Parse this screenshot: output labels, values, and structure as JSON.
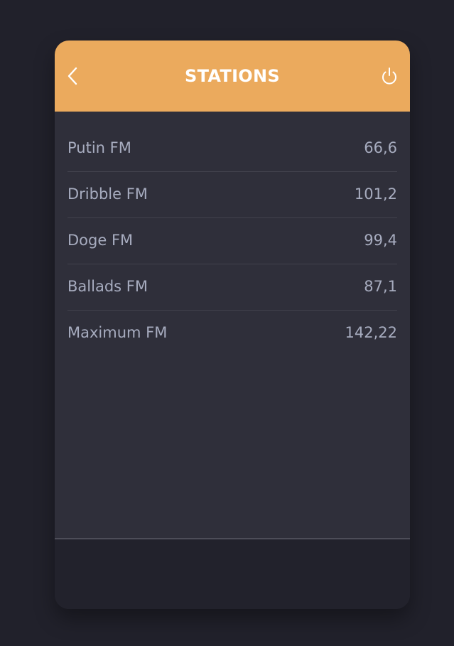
{
  "header": {
    "title": "STATIONS",
    "back_icon": "chevron-left-icon",
    "power_icon": "power-icon",
    "color": "#ebaa5d"
  },
  "stations": [
    {
      "name": "Putin FM",
      "frequency": "66,6"
    },
    {
      "name": "Dribble FM",
      "frequency": "101,2"
    },
    {
      "name": "Doge FM",
      "frequency": "99,4"
    },
    {
      "name": "Ballads FM",
      "frequency": "87,1"
    },
    {
      "name": "Maximum FM",
      "frequency": "142,22"
    }
  ],
  "colors": {
    "background": "#21212b",
    "card": "#2f2f3a",
    "footer": "#22222c",
    "text": "#a7acbf"
  }
}
